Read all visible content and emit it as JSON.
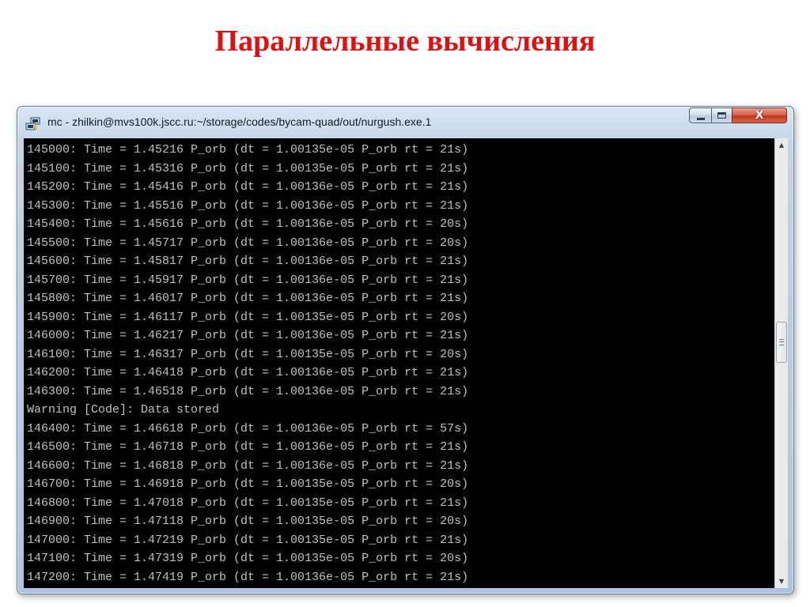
{
  "slide": {
    "title": "Параллельные вычисления"
  },
  "window": {
    "title": "mc - zhilkin@mvs100k.jscc.ru:~/storage/codes/bycam-quad/out/nurgush.exe.1",
    "icon": "putty-icon",
    "controls": {
      "minimize": "minimize-icon",
      "maximize": "maximize-icon",
      "close_label": "X"
    }
  },
  "terminal": {
    "lines": [
      "145000: Time = 1.45216 P_orb (dt = 1.00135e-05 P_orb rt = 21s)",
      "145100: Time = 1.45316 P_orb (dt = 1.00135e-05 P_orb rt = 21s)",
      "145200: Time = 1.45416 P_orb (dt = 1.00136e-05 P_orb rt = 21s)",
      "145300: Time = 1.45516 P_orb (dt = 1.00136e-05 P_orb rt = 21s)",
      "145400: Time = 1.45616 P_orb (dt = 1.00136e-05 P_orb rt = 20s)",
      "145500: Time = 1.45717 P_orb (dt = 1.00136e-05 P_orb rt = 20s)",
      "145600: Time = 1.45817 P_orb (dt = 1.00136e-05 P_orb rt = 21s)",
      "145700: Time = 1.45917 P_orb (dt = 1.00136e-05 P_orb rt = 21s)",
      "145800: Time = 1.46017 P_orb (dt = 1.00136e-05 P_orb rt = 21s)",
      "145900: Time = 1.46117 P_orb (dt = 1.00135e-05 P_orb rt = 20s)",
      "146000: Time = 1.46217 P_orb (dt = 1.00136e-05 P_orb rt = 21s)",
      "146100: Time = 1.46317 P_orb (dt = 1.00135e-05 P_orb rt = 20s)",
      "146200: Time = 1.46418 P_orb (dt = 1.00136e-05 P_orb rt = 21s)",
      "146300: Time = 1.46518 P_orb (dt = 1.00136e-05 P_orb rt = 21s)",
      "Warning [Code]: Data stored",
      "146400: Time = 1.46618 P_orb (dt = 1.00136e-05 P_orb rt = 57s)",
      "146500: Time = 1.46718 P_orb (dt = 1.00136e-05 P_orb rt = 21s)",
      "146600: Time = 1.46818 P_orb (dt = 1.00136e-05 P_orb rt = 21s)",
      "146700: Time = 1.46918 P_orb (dt = 1.00135e-05 P_orb rt = 20s)",
      "146800: Time = 1.47018 P_orb (dt = 1.00135e-05 P_orb rt = 21s)",
      "146900: Time = 1.47118 P_orb (dt = 1.00135e-05 P_orb rt = 20s)",
      "147000: Time = 1.47219 P_orb (dt = 1.00135e-05 P_orb rt = 21s)",
      "147100: Time = 1.47319 P_orb (dt = 1.00135e-05 P_orb rt = 20s)",
      "147200: Time = 1.47419 P_orb (dt = 1.00136e-05 P_orb rt = 21s)"
    ],
    "scrollbar": {
      "up_icon": "scroll-up-arrow-icon",
      "down_icon": "scroll-down-arrow-icon"
    }
  },
  "colors": {
    "title_red": "#e01010",
    "terminal_bg": "#000000",
    "terminal_text": "#c0c0c0"
  }
}
